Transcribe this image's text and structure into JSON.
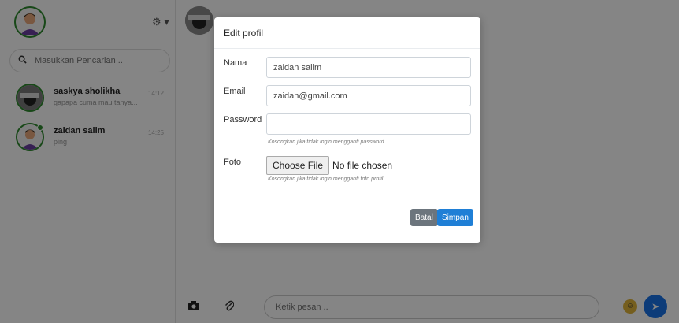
{
  "sidebar": {
    "search_placeholder": "Masukkan Pencarian ..",
    "contacts": [
      {
        "name": "saskya sholikha",
        "last_message": "gapapa cuma mau tanya...",
        "time": "14:12"
      },
      {
        "name": "zaidan salim",
        "last_message": "ping",
        "time": "14:25"
      }
    ]
  },
  "chat": {
    "message_placeholder": "Ketik pesan .."
  },
  "modal": {
    "title": "Edit profil",
    "fields": {
      "name_label": "Nama",
      "name_value": "zaidan salim",
      "email_label": "Email",
      "email_value": "zaidan@gmail.com",
      "password_label": "Password",
      "password_value": "",
      "password_help": "Kosongkan jika tidak ingin mengganti password.",
      "photo_label": "Foto",
      "file_button": "Choose File",
      "file_status": "No file chosen",
      "photo_help": "Kosongkan jika tidak ingin mengganti foto profil."
    },
    "buttons": {
      "cancel": "Batal",
      "save": "Simpan"
    }
  },
  "colors": {
    "online": "#2e8b2e",
    "primary": "#1f7fd6",
    "secondary": "#6c757d",
    "send": "#1a73e8"
  },
  "icons": [
    "gear-icon",
    "search-icon",
    "camera-icon",
    "paperclip-icon",
    "emoji-icon",
    "send-icon"
  ]
}
